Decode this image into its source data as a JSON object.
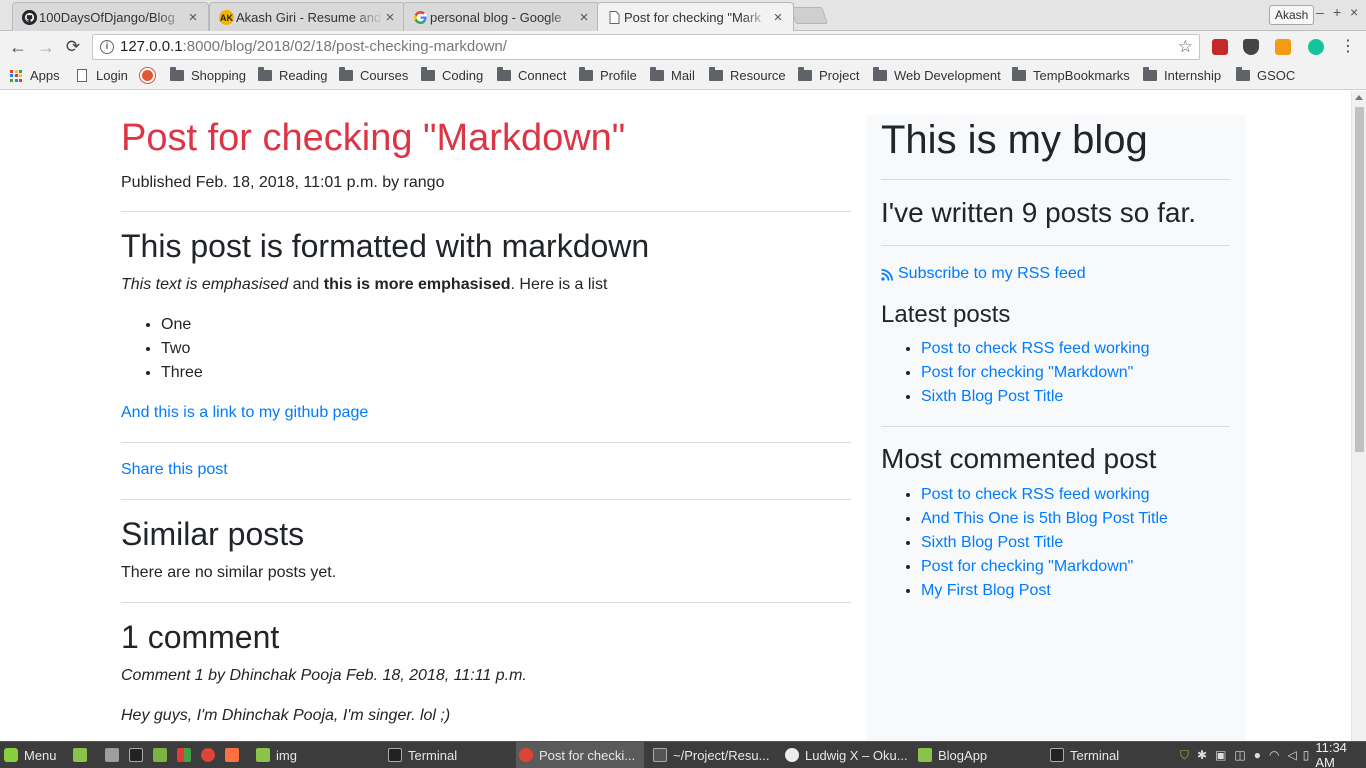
{
  "browser": {
    "tabs": [
      {
        "title": "100DaysOfDjango/Blog",
        "icon": "github-icon"
      },
      {
        "title": "Akash Giri - Resume and",
        "icon": "ak-logo-icon"
      },
      {
        "title": "personal blog - Google",
        "icon": "google-icon"
      },
      {
        "title": "Post for checking \"Mark",
        "icon": "page-icon"
      }
    ],
    "profile_label": "Akash",
    "url_host": "127.0.0.1",
    "url_path": ":8000/blog/2018/02/18/post-checking-markdown/",
    "bookmarks": [
      "Apps",
      "Login",
      "",
      "Shopping",
      "Reading",
      "Courses",
      "Coding",
      "Connect",
      "Profile",
      "Mail",
      "Resource",
      "Project",
      "Web Development",
      "TempBookmarks",
      "Internship",
      "GSOC"
    ]
  },
  "post": {
    "title": "Post for checking \"Markdown\"",
    "meta": "Published Feb. 18, 2018, 11:01 p.m. by rango",
    "heading": "This post is formatted with markdown",
    "em_text": "This text is emphasised",
    "and_text": " and ",
    "strong_text": "this is more emphasised",
    "tail_text": ". Here is a list",
    "list": [
      "One",
      "Two",
      "Three"
    ],
    "link_text": "And this is a link to my github page",
    "share_label": "Share this post",
    "similar_heading": "Similar posts",
    "similar_text": "There are no similar posts yet.",
    "comments_heading": "1 comment",
    "comment_meta": "Comment 1 by Dhinchak Pooja Feb. 18, 2018, 11:11 p.m.",
    "comment_body": "Hey guys, I'm Dhinchak Pooja, I'm singer. lol ;)"
  },
  "sidebar": {
    "title": "This is my blog",
    "count_text": "I've written 9 posts so far.",
    "rss_label": "Subscribe to my RSS feed",
    "latest_heading": "Latest posts",
    "latest": [
      "Post to check RSS feed working",
      "Post for checking \"Markdown\"",
      "Sixth Blog Post Title"
    ],
    "commented_heading": "Most commented post",
    "commented": [
      "Post to check RSS feed working",
      "And This One is 5th Blog Post Title",
      "Sixth Blog Post Title",
      "Post for checking \"Markdown\"",
      "My First Blog Post"
    ]
  },
  "taskbar": {
    "menu_label": "Menu",
    "windows": [
      "img",
      "Terminal",
      "Post for checki...",
      "~/Project/Resu...",
      "Ludwig X – Oku...",
      "BlogApp",
      "Terminal"
    ],
    "clock": "11:34 AM"
  },
  "colors": {
    "post_title": "#dc3545",
    "link": "#007bff",
    "sidebar_bg": "#f8f9fa"
  }
}
